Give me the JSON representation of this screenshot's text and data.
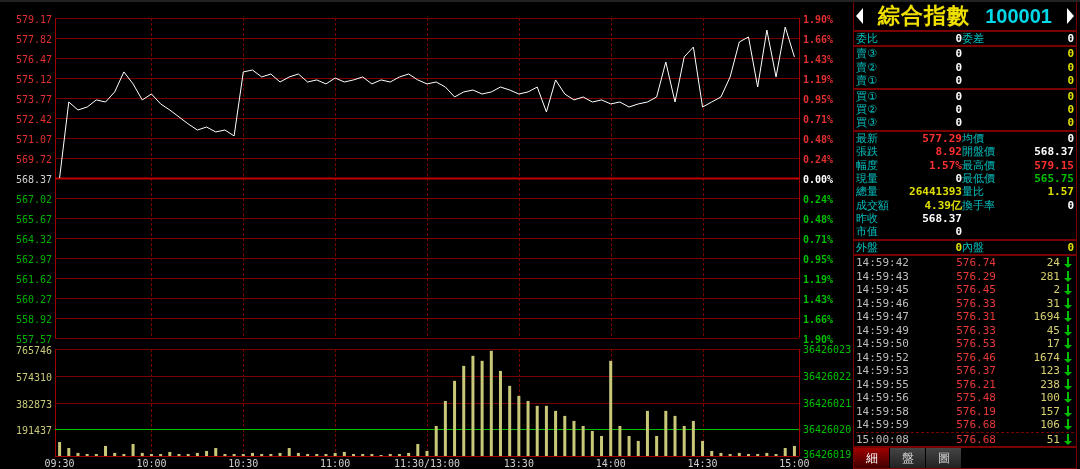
{
  "price_chart": {
    "chart_data": {
      "type": "line",
      "grid": true,
      "categories": [
        null,
        null,
        null,
        null,
        null,
        null,
        null,
        null,
        null,
        null,
        null,
        null,
        null,
        null,
        null,
        null,
        null,
        null,
        null,
        null,
        null,
        null,
        null,
        null,
        null,
        null,
        null,
        null,
        null,
        null,
        null,
        null,
        null,
        null,
        null,
        null,
        null,
        null,
        null,
        null,
        null,
        null,
        null,
        null,
        null,
        null,
        null,
        null,
        null,
        null,
        null,
        null,
        null,
        null,
        null,
        null,
        null,
        null,
        null,
        null,
        null,
        null,
        null,
        null,
        null,
        null,
        null,
        null,
        null,
        null,
        null,
        null,
        null,
        null,
        null,
        null,
        null,
        null,
        null,
        null,
        null
      ],
      "series": [
        {
          "color": "#ffffff",
          "values": [
            568.37,
            573.5,
            572.96,
            573.16,
            573.64,
            573.5,
            574.18,
            575.53,
            574.72,
            573.64,
            574.04,
            573.37,
            572.96,
            572.49,
            572.02,
            571.61,
            571.81,
            571.48,
            571.61,
            571.21,
            575.53,
            575.66,
            575.19,
            575.39,
            574.85,
            575.19,
            575.39,
            574.85,
            574.99,
            574.72,
            575.12,
            574.85,
            574.99,
            575.19,
            574.72,
            574.99,
            574.85,
            575.19,
            575.39,
            574.99,
            574.72,
            574.85,
            574.51,
            573.84,
            574.18,
            574.31,
            574.04,
            574.18,
            574.51,
            574.31,
            574.04,
            574.18,
            574.51,
            572.83,
            574.99,
            574.04,
            573.64,
            573.84,
            573.5,
            573.64,
            573.37,
            573.5,
            573.16,
            573.37,
            573.5,
            573.84,
            576.2,
            573.5,
            576.54,
            577.21,
            573.16,
            573.5,
            573.84,
            575.19,
            577.55,
            577.89,
            574.51,
            578.36,
            575.19,
            578.56,
            576.54
          ]
        }
      ],
      "ylim": [
        557.57,
        579.17
      ],
      "yticks": [
        {
          "value": 579.17,
          "label": "579.17"
        },
        {
          "value": 577.82,
          "label": "577.82"
        },
        {
          "value": 576.47,
          "label": "576.47"
        },
        {
          "value": 575.12,
          "label": "575.12"
        },
        {
          "value": 573.77,
          "label": "573.77"
        },
        {
          "value": 572.42,
          "label": "572.42"
        },
        {
          "value": 571.07,
          "label": "571.07"
        },
        {
          "value": 569.72,
          "label": "569.72"
        },
        {
          "value": 568.37,
          "label": "568.37"
        },
        {
          "value": 567.02,
          "label": "567.02"
        },
        {
          "value": 565.67,
          "label": "565.67"
        },
        {
          "value": 564.32,
          "label": "564.32"
        },
        {
          "value": 562.97,
          "label": "562.97"
        },
        {
          "value": 561.62,
          "label": "561.62"
        },
        {
          "value": 560.27,
          "label": "560.27"
        },
        {
          "value": 558.92,
          "label": "558.92"
        },
        {
          "value": 557.57,
          "label": "557.57"
        }
      ],
      "ref_lines": [
        {
          "axis": "y",
          "value": 568.37,
          "color": "#c00000"
        }
      ]
    },
    "right_ticks": [
      {
        "label": "1.90%",
        "color": "#e03030"
      },
      {
        "label": "1.66%",
        "color": "#e03030"
      },
      {
        "label": "1.43%",
        "color": "#e03030"
      },
      {
        "label": "1.19%",
        "color": "#e03030"
      },
      {
        "label": "0.95%",
        "color": "#e03030"
      },
      {
        "label": "0.71%",
        "color": "#e03030"
      },
      {
        "label": "0.48%",
        "color": "#e03030"
      },
      {
        "label": "0.24%",
        "color": "#e03030"
      },
      {
        "label": "0.00%",
        "color": "#ffffff"
      },
      {
        "label": "0.24%",
        "color": "#00c000"
      },
      {
        "label": "0.48%",
        "color": "#00c000"
      },
      {
        "label": "0.71%",
        "color": "#00c000"
      },
      {
        "label": "0.95%",
        "color": "#00c000"
      },
      {
        "label": "1.19%",
        "color": "#00c000"
      },
      {
        "label": "1.43%",
        "color": "#00c000"
      },
      {
        "label": "1.66%",
        "color": "#00c000"
      },
      {
        "label": "1.90%",
        "color": "#00c000"
      }
    ]
  },
  "volume_chart": {
    "chart_data": {
      "type": "bar",
      "grid": true,
      "categories": [
        "09:30",
        null,
        null,
        null,
        null,
        null,
        null,
        null,
        null,
        null,
        "10:00",
        null,
        null,
        null,
        null,
        null,
        null,
        null,
        null,
        null,
        "10:30",
        null,
        null,
        null,
        null,
        null,
        null,
        null,
        null,
        null,
        "11:00",
        null,
        null,
        null,
        null,
        null,
        null,
        null,
        null,
        null,
        "11:30/13:00",
        null,
        null,
        null,
        null,
        null,
        null,
        null,
        null,
        null,
        "13:30",
        null,
        null,
        null,
        null,
        null,
        null,
        null,
        null,
        null,
        "14:00",
        null,
        null,
        null,
        null,
        null,
        null,
        null,
        null,
        null,
        "14:30",
        null,
        null,
        null,
        null,
        null,
        null,
        null,
        null,
        null,
        "15:00"
      ],
      "series": [
        {
          "color": "#c8c878",
          "values": [
            100000,
            57000,
            22000,
            14000,
            14000,
            72000,
            22000,
            14000,
            86000,
            22000,
            14000,
            14000,
            29000,
            14000,
            14000,
            22000,
            36000,
            57000,
            14000,
            14000,
            14000,
            22000,
            14000,
            14000,
            22000,
            57000,
            22000,
            14000,
            14000,
            14000,
            22000,
            29000,
            14000,
            14000,
            14000,
            7000,
            14000,
            14000,
            22000,
            86000,
            36000,
            215000,
            394000,
            538000,
            645000,
            717000,
            681000,
            753000,
            609000,
            502000,
            430000,
            394000,
            359000,
            359000,
            323000,
            287000,
            251000,
            215000,
            179000,
            143000,
            681000,
            215000,
            143000,
            108000,
            323000,
            143000,
            323000,
            287000,
            215000,
            251000,
            108000,
            36000,
            22000,
            14000,
            22000,
            14000,
            14000,
            22000,
            14000,
            57000,
            72000
          ]
        }
      ],
      "ylim": [
        0,
        765746
      ],
      "yticks": [
        {
          "value": 765746,
          "label": "765746"
        },
        {
          "value": 574310,
          "label": "574310"
        },
        {
          "value": 382873,
          "label": "382873"
        },
        {
          "value": 191437,
          "label": "191437"
        }
      ],
      "ref_lines": [
        {
          "axis": "y",
          "value": 191437,
          "color": "#00c000"
        }
      ]
    },
    "right_ticks": [
      "36426023",
      "36426022",
      "36426021",
      "36426020",
      "36426019"
    ]
  },
  "panel": {
    "title": "綜合指數",
    "code": "100001",
    "sections": [
      {
        "rows": [
          {
            "cells": [
              {
                "label": "委比",
                "value": "0",
                "color": "#ffffff"
              },
              {
                "label": "委差",
                "value": "0",
                "color": "#ffffff"
              }
            ]
          }
        ]
      },
      {
        "rows": [
          {
            "cells": [
              {
                "label": "賣③",
                "value": "0",
                "color": "#ffffff"
              },
              {
                "value": "0",
                "color": "#e0e000"
              }
            ]
          },
          {
            "cells": [
              {
                "label": "賣②",
                "value": "0",
                "color": "#ffffff"
              },
              {
                "value": "0",
                "color": "#e0e000"
              }
            ]
          },
          {
            "cells": [
              {
                "label": "賣①",
                "value": "0",
                "color": "#ffffff"
              },
              {
                "value": "0",
                "color": "#e0e000"
              }
            ]
          }
        ]
      },
      {
        "rows": [
          {
            "cells": [
              {
                "label": "買①",
                "value": "0",
                "color": "#ffffff"
              },
              {
                "value": "0",
                "color": "#e0e000"
              }
            ]
          },
          {
            "cells": [
              {
                "label": "買②",
                "value": "0",
                "color": "#ffffff"
              },
              {
                "value": "0",
                "color": "#e0e000"
              }
            ]
          },
          {
            "cells": [
              {
                "label": "買③",
                "value": "0",
                "color": "#ffffff"
              },
              {
                "value": "0",
                "color": "#e0e000"
              }
            ]
          }
        ]
      },
      {
        "rows": [
          {
            "cells": [
              {
                "label": "最新",
                "value": "577.29",
                "color": "#ff3030"
              },
              {
                "label": "均價",
                "value": "0",
                "color": "#ffffff"
              }
            ]
          },
          {
            "cells": [
              {
                "label": "張跌",
                "value": "8.92",
                "color": "#ff3030"
              },
              {
                "label": "開盤價",
                "value": "568.37",
                "color": "#ffffff"
              }
            ]
          },
          {
            "cells": [
              {
                "label": "幅度",
                "value": "1.57%",
                "color": "#ff3030"
              },
              {
                "label": "最高價",
                "value": "579.15",
                "color": "#ff3030"
              }
            ]
          },
          {
            "cells": [
              {
                "label": "現量",
                "value": "0",
                "color": "#ffffff"
              },
              {
                "label": "最低價",
                "value": "565.75",
                "color": "#00c000"
              }
            ]
          },
          {
            "cells": [
              {
                "label": "總量",
                "value": "26441393",
                "color": "#e0e000"
              },
              {
                "label": "量比",
                "value": "1.57",
                "color": "#e0e000"
              }
            ]
          },
          {
            "cells": [
              {
                "label": "成交額",
                "value": "4.39亿",
                "color": "#e0e000"
              },
              {
                "label": "換手率",
                "value": "0",
                "color": "#ffffff"
              }
            ]
          },
          {
            "cells": [
              {
                "label": "昨收",
                "value": "568.37",
                "color": "#ffffff"
              }
            ]
          },
          {
            "cells": [
              {
                "label": "市值",
                "value": "0",
                "color": "#ffffff"
              }
            ]
          }
        ]
      },
      {
        "rows": [
          {
            "cells": [
              {
                "label": "外盤",
                "value": "0",
                "color": "#e0e000"
              },
              {
                "label": "內盤",
                "value": "0",
                "color": "#e0e000"
              }
            ]
          }
        ]
      }
    ],
    "ticks": [
      {
        "time": "14:59:42",
        "price": "576.74",
        "volume": "24",
        "kind": "down",
        "latest": false
      },
      {
        "time": "14:59:43",
        "price": "576.29",
        "volume": "281",
        "kind": "down",
        "latest": false
      },
      {
        "time": "14:59:45",
        "price": "576.45",
        "volume": "2",
        "kind": "down",
        "latest": false
      },
      {
        "time": "14:59:46",
        "price": "576.33",
        "volume": "31",
        "kind": "down",
        "latest": false
      },
      {
        "time": "14:59:47",
        "price": "576.31",
        "volume": "1694",
        "kind": "down",
        "latest": false
      },
      {
        "time": "14:59:49",
        "price": "576.33",
        "volume": "45",
        "kind": "down",
        "latest": false
      },
      {
        "time": "14:59:50",
        "price": "576.53",
        "volume": "17",
        "kind": "down",
        "latest": false
      },
      {
        "time": "14:59:52",
        "price": "576.46",
        "volume": "1674",
        "kind": "down",
        "latest": false
      },
      {
        "time": "14:59:53",
        "price": "576.37",
        "volume": "123",
        "kind": "down",
        "latest": false
      },
      {
        "time": "14:59:55",
        "price": "576.21",
        "volume": "238",
        "kind": "down",
        "latest": false
      },
      {
        "time": "14:59:56",
        "price": "575.48",
        "volume": "100",
        "kind": "down",
        "latest": false
      },
      {
        "time": "14:59:58",
        "price": "576.19",
        "volume": "157",
        "kind": "down",
        "latest": false
      },
      {
        "time": "14:59:59",
        "price": "576.68",
        "volume": "106",
        "kind": "down",
        "latest": false
      },
      {
        "time": "15:00:08",
        "price": "576.68",
        "volume": "51",
        "kind": "down",
        "latest": true
      }
    ],
    "tabs": [
      {
        "label": "細",
        "selected": true
      },
      {
        "label": "盤",
        "selected": false
      },
      {
        "label": "圖",
        "selected": false
      }
    ]
  }
}
